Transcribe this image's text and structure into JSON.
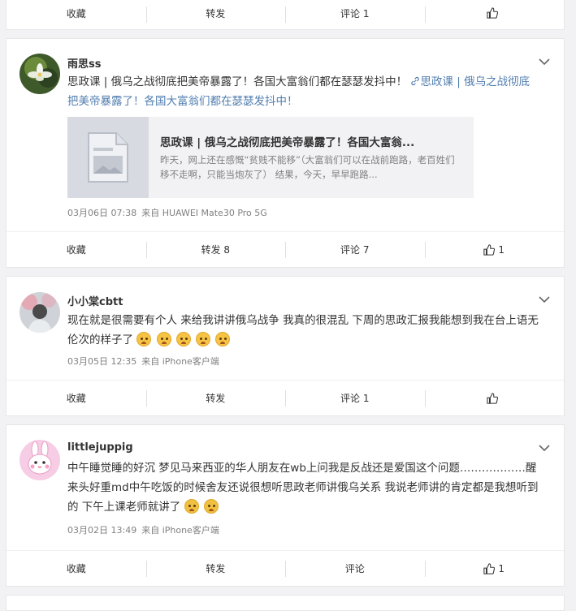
{
  "top_actions": {
    "collect": "收藏",
    "repost": "转发",
    "comment": "评论 1",
    "like": ""
  },
  "posts": [
    {
      "username": "雨思ss",
      "text": "思政课 | 俄乌之战彻底把美帝暴露了！各国大富翁们都在瑟瑟发抖中！",
      "link_text": "思政课 | 俄乌之战彻底把美帝暴露了！各国大富翁们都在瑟瑟发抖中！",
      "card_title": "思政课 | 俄乌之战彻底把美帝暴露了！各国大富翁...",
      "card_desc": "昨天，网上还在感慨“贫贱不能移”（大富翁们可以在战前跑路，老百姓们移不走啊，只能当炮灰了） 结果，今天，早早跑路...",
      "date": "03月06日 07:38",
      "source": "来自 HUAWEI Mate30 Pro 5G",
      "actions": {
        "collect": "收藏",
        "repost": "转发 8",
        "comment": "评论 7",
        "like": "1"
      }
    },
    {
      "username": "小小棠cbtt",
      "text": "现在就是很需要有个人 来给我讲讲俄乌战争 我真的很混乱 下周的思政汇报我能想到我在台上语无伦次的样子了",
      "date": "03月05日 12:35",
      "source": "来自 iPhone客户端",
      "actions": {
        "collect": "收藏",
        "repost": "转发",
        "comment": "评论 1",
        "like": ""
      }
    },
    {
      "username": "littlejuppig",
      "text": "中午睡觉睡的好沉 梦见马来西亚的华人朋友在wb上问我是反战还是爱国这个问题………………醒来头好重md中午吃饭的时候舍友还说很想听思政老师讲俄乌关系 我说老师讲的肯定都是我想听到的 下午上课老师就讲了",
      "date": "03月02日 13:49",
      "source": "来自 iPhone客户端",
      "actions": {
        "collect": "收藏",
        "repost": "转发",
        "comment": "评论",
        "like": "1"
      }
    }
  ],
  "colors": {
    "link": "#507daf",
    "meta": "#808080",
    "background": "#f2f2f5"
  }
}
